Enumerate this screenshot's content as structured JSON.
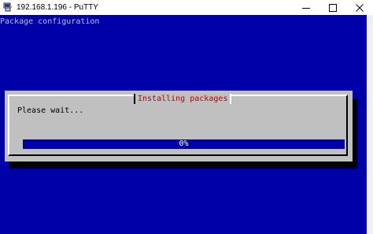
{
  "window": {
    "title": "192.168.1.196 - PuTTY",
    "app_icon": "putty-icon",
    "controls": [
      "minimize-icon",
      "maximize-icon",
      "close-icon"
    ]
  },
  "terminal": {
    "header": "Package configuration"
  },
  "dialog": {
    "title": "Installing packages",
    "message": "Please wait...",
    "progress_label": "0%",
    "progress_fraction": 0
  },
  "colors": {
    "terminal_background": "#0000a8",
    "dialog_background": "#c0c0c0",
    "dialog_title": "#c00000",
    "terminal_text": "#c0c0c0"
  }
}
